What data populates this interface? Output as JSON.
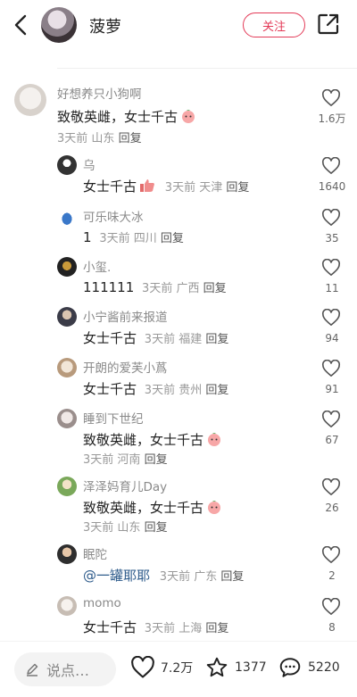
{
  "header": {
    "name": "菠萝",
    "follow_label": "关注"
  },
  "main_comment": {
    "user": "好想养只小狗啊",
    "text": "致敬英雌，女士千古",
    "time": "3天前",
    "location": "山东",
    "reply_label": "回复",
    "likes": "1.6万"
  },
  "replies": [
    {
      "user": "乌",
      "text": "女士千古",
      "time": "3天前",
      "location": "天津",
      "reply_label": "回复",
      "likes": "1640"
    },
    {
      "user": "可乐味大冰",
      "text": "1",
      "time": "3天前",
      "location": "四川",
      "reply_label": "回复",
      "likes": "35"
    },
    {
      "user": "小玺.",
      "text": "111111",
      "time": "3天前",
      "location": "广西",
      "reply_label": "回复",
      "likes": "11"
    },
    {
      "user": "小宁酱前来报道",
      "text": "女士千古",
      "time": "3天前",
      "location": "福建",
      "reply_label": "回复",
      "likes": "94"
    },
    {
      "user": "开朗的爱芙小蔿",
      "text": "女士千古",
      "time": "3天前",
      "location": "贵州",
      "reply_label": "回复",
      "likes": "91"
    },
    {
      "user": "睡到下世纪",
      "text": "致敬英雌，女士千古",
      "time": "3天前",
      "location": "河南",
      "reply_label": "回复",
      "likes": "67"
    },
    {
      "user": "泽泽妈育儿Day",
      "text": "致敬英雌，女士千古",
      "time": "3天前",
      "location": "山东",
      "reply_label": "回复",
      "likes": "26"
    },
    {
      "user": "眠陀",
      "text": "@一罐耶耶",
      "time": "3天前",
      "location": "广东",
      "reply_label": "回复",
      "likes": "2"
    },
    {
      "user": "momo",
      "text": "女士千古",
      "time": "3天前",
      "location": "上海",
      "reply_label": "回复",
      "likes": "8"
    }
  ],
  "bottom_bar": {
    "input_placeholder": "说点…",
    "likes": "7.2万",
    "stars": "1377",
    "comments": "5220"
  },
  "colors": {
    "accent": "#e33a57"
  },
  "icons": {
    "back": "chevron-left-icon",
    "share": "share-icon",
    "like": "heart-icon",
    "pen": "pen-icon",
    "star": "star-icon",
    "comment": "comment-bubble-icon",
    "emoji_peach": "peach-face-emoji",
    "emoji_thumb": "thumbs-up-emoji"
  }
}
